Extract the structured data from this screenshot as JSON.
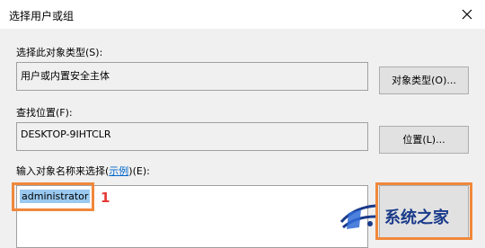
{
  "window": {
    "title": "选择用户或组"
  },
  "object_type": {
    "label": "选择此对象类型(S):",
    "value": "用户或内置安全主体",
    "button": "对象类型(O)..."
  },
  "location": {
    "label": "查找位置(F):",
    "value": "DESKTOP-9IHTCLR",
    "button": "位置(L)..."
  },
  "object_names": {
    "label_prefix": "输入对象名称来选择(",
    "label_link": "示例",
    "label_suffix": ")(E):",
    "value": "administrator"
  },
  "annotation": {
    "step_number": "1",
    "color": "#f0883b"
  },
  "watermark": {
    "text": "系统之家"
  }
}
